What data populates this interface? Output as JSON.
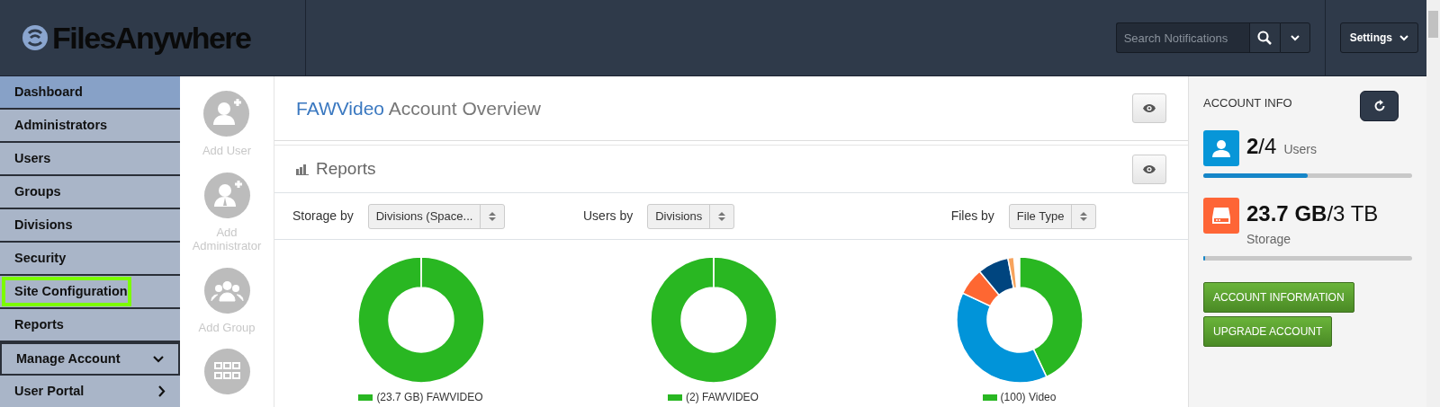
{
  "header": {
    "logo": "FilesAnywhere",
    "search": {
      "placeholder": "Search Notifications"
    },
    "settings": "Settings"
  },
  "sidebar": {
    "items": [
      {
        "label": "Dashboard",
        "selected": true,
        "highlighted": false
      },
      {
        "label": "Administrators",
        "selected": false,
        "highlighted": false
      },
      {
        "label": "Users",
        "selected": false,
        "highlighted": false
      },
      {
        "label": "Groups",
        "selected": false,
        "highlighted": false
      },
      {
        "label": "Divisions",
        "selected": false,
        "highlighted": false
      },
      {
        "label": "Security",
        "selected": false,
        "highlighted": false
      },
      {
        "label": "Site Configuration",
        "selected": false,
        "highlighted": true
      },
      {
        "label": "Reports",
        "selected": false,
        "highlighted": false
      },
      {
        "label": "Manage Account",
        "selected": false,
        "highlighted": false,
        "kind": "dropdown"
      },
      {
        "label": "User Portal",
        "selected": false,
        "highlighted": false,
        "kind": "flyout"
      }
    ]
  },
  "quick_actions": [
    {
      "kind": "add-user",
      "label": "Add User"
    },
    {
      "kind": "add-admin",
      "label": "Add Administrator"
    },
    {
      "kind": "add-group",
      "label": "Add Group"
    },
    {
      "kind": "grid"
    }
  ],
  "overview": {
    "account": "FAWVideo",
    "title": "Account Overview"
  },
  "reports": {
    "title": "Reports",
    "filters": [
      {
        "label": "Storage by",
        "value": "Divisions (Space..."
      },
      {
        "label": "Users by",
        "value": "Divisions"
      },
      {
        "label": "Files by",
        "value": "File Type"
      }
    ],
    "charts": [
      {
        "kind": "full",
        "legend": "(23.7 GB) FAWVIDEO"
      },
      {
        "kind": "full",
        "legend": "(2) FAWVIDEO"
      },
      {
        "kind": "mixed",
        "legend": "(100) Video"
      }
    ]
  },
  "account_info": {
    "title": "ACCOUNT INFO",
    "stats": [
      {
        "kind": "users",
        "used": "2",
        "total": "/4",
        "unit": "Users",
        "level": 0.5
      },
      {
        "kind": "storage",
        "used": "23.7 GB",
        "total": "/3 TB",
        "unit": "Storage",
        "level": 0.01
      }
    ],
    "buttons": [
      "ACCOUNT INFORMATION",
      "UPGRADE ACCOUNT"
    ]
  }
}
